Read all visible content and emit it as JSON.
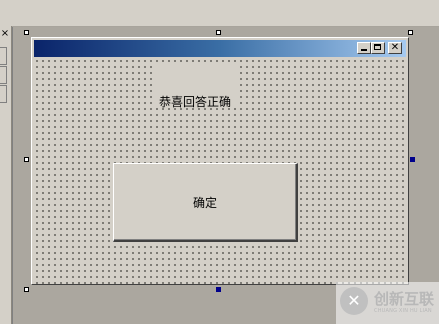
{
  "left_panel": {
    "close_glyph": "×"
  },
  "form": {
    "title": "",
    "controls": {
      "minimize_icon": "minimize-icon",
      "maximize_icon": "maximize-icon",
      "close_glyph": "✕"
    },
    "label_text": "恭喜回答正确",
    "ok_button_label": "确定"
  },
  "watermark": {
    "brand": "创新互联",
    "sub": "CHUANG XIN HU LIAN"
  },
  "colors": {
    "titlebar_start": "#0a246a",
    "titlebar_end": "#a6caf0",
    "face": "#d4d0c8",
    "selection_handle": "#00008b"
  }
}
